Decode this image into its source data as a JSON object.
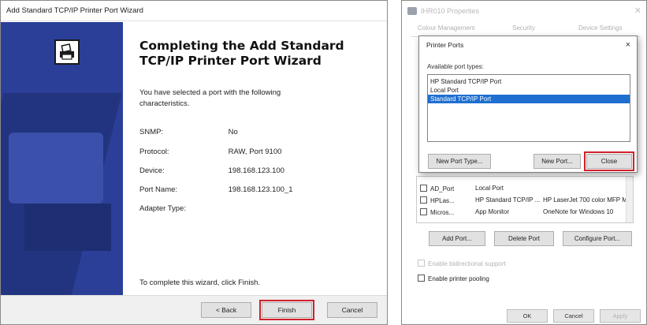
{
  "wizard": {
    "window_title": "Add Standard TCP/IP Printer Port Wizard",
    "heading": "Completing the Add Standard TCP/IP Printer Port Wizard",
    "intro": "You have selected a port with the following characteristics.",
    "fields": [
      {
        "label": "SNMP:",
        "value": "No"
      },
      {
        "label": "Protocol:",
        "value": "RAW, Port 9100"
      },
      {
        "label": "Device:",
        "value": "198.168.123.100"
      },
      {
        "label": "Port Name:",
        "value": "198.168.123.100_1"
      },
      {
        "label": "Adapter Type:",
        "value": ""
      }
    ],
    "complete_text": "To complete this wizard, click Finish.",
    "buttons": {
      "back": "< Back",
      "finish": "Finish",
      "cancel": "Cancel"
    }
  },
  "properties": {
    "window_title": "IHR010 Properties",
    "tabs": [
      "Colour Management",
      "Security",
      "Device Settings"
    ],
    "port_rows": [
      {
        "col1": "AD_Port",
        "col2": "Local Port",
        "col3": ""
      },
      {
        "col1": "HPLas...",
        "col2": "HP Standard TCP/IP ...",
        "col3": "HP LaserJet 700 color MFP M..."
      },
      {
        "col1": "Micros...",
        "col2": "App Monitor",
        "col3": "OneNote for Windows 10"
      }
    ],
    "buttons": {
      "add_port": "Add Port...",
      "delete_port": "Delete Port",
      "configure_port": "Configure Port..."
    },
    "options": {
      "bidirectional": "Enable bidirectional support",
      "pooling": "Enable printer pooling"
    },
    "bottom_buttons": {
      "ok": "OK",
      "cancel": "Cancel",
      "apply": "Apply"
    }
  },
  "printer_ports_dialog": {
    "title": "Printer Ports",
    "close_symbol": "×",
    "label": "Available port types:",
    "port_types": [
      "HP Standard TCP/IP Port",
      "Local Port",
      "Standard TCP/IP Port"
    ],
    "selected_index": 2,
    "buttons": {
      "new_port_type": "New Port Type...",
      "new_port": "New Port...",
      "close": "Close"
    }
  }
}
